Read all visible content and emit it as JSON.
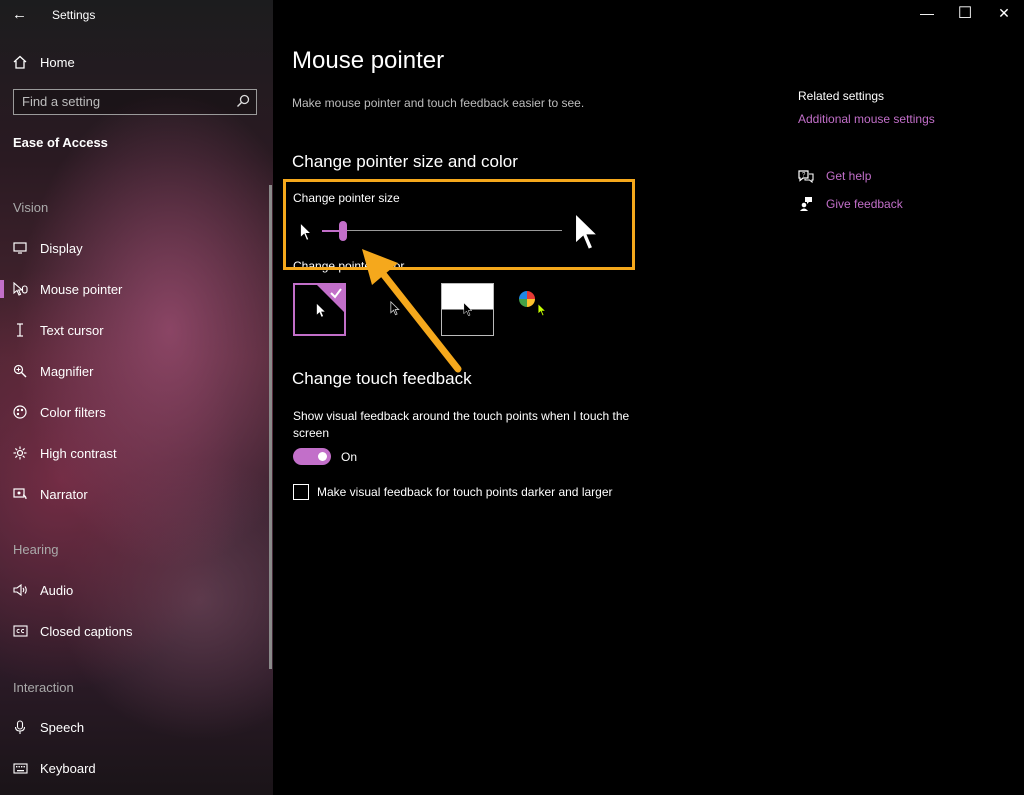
{
  "app": {
    "title": "Settings"
  },
  "sidebar": {
    "home_label": "Home",
    "search_placeholder": "Find a setting",
    "section_title": "Ease of Access",
    "groups": {
      "vision": "Vision",
      "hearing": "Hearing",
      "interaction": "Interaction"
    },
    "items": [
      {
        "label": "Display",
        "icon": "display-icon"
      },
      {
        "label": "Mouse pointer",
        "icon": "mouse-pointer-icon",
        "active": true
      },
      {
        "label": "Text cursor",
        "icon": "text-cursor-icon"
      },
      {
        "label": "Magnifier",
        "icon": "magnifier-icon"
      },
      {
        "label": "Color filters",
        "icon": "color-filters-icon"
      },
      {
        "label": "High contrast",
        "icon": "high-contrast-icon"
      },
      {
        "label": "Narrator",
        "icon": "narrator-icon"
      },
      {
        "label": "Audio",
        "icon": "audio-icon"
      },
      {
        "label": "Closed captions",
        "icon": "closed-captions-icon"
      },
      {
        "label": "Speech",
        "icon": "microphone-icon"
      },
      {
        "label": "Keyboard",
        "icon": "keyboard-icon"
      }
    ]
  },
  "main": {
    "title": "Mouse pointer",
    "subtitle": "Make mouse pointer and touch feedback easier to see.",
    "size_color_heading": "Change pointer size and color",
    "pointer_size_label": "Change pointer size",
    "pointer_size_value": 0.07,
    "pointer_color_label": "Change pointer color",
    "pointer_color_options": [
      "white",
      "black",
      "inverted",
      "custom"
    ],
    "pointer_color_selected": "white",
    "touch_heading": "Change touch feedback",
    "touch_desc": "Show visual feedback around the touch points when I touch the screen",
    "toggle_state": "On",
    "checkbox_label": "Make visual feedback for touch points darker and larger",
    "checkbox_checked": false
  },
  "related": {
    "title": "Related settings",
    "link": "Additional mouse settings",
    "help_label": "Get help",
    "feedback_label": "Give feedback"
  },
  "colors": {
    "accent": "#c26fc9",
    "highlight": "#f5a81c",
    "background": "#000000"
  }
}
